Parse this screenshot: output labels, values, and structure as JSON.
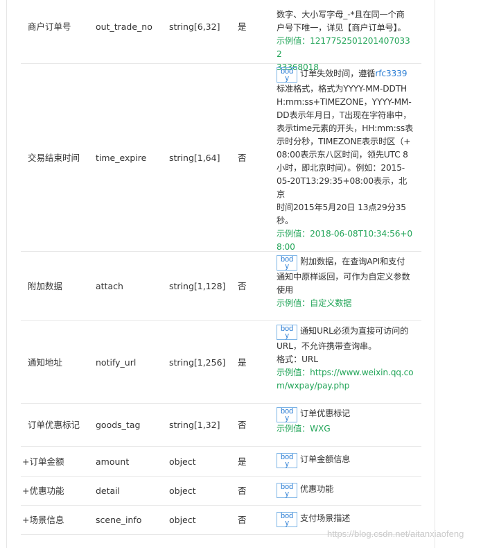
{
  "badge": "body",
  "rows": [
    {
      "name": "商户订单号",
      "field": "out_trade_no",
      "type": "string[6,32]",
      "required": "是",
      "desc_lines": [
        "数字、大小写字母_-*且在同一个商",
        "户号下唯一，详见【商户订单号】。"
      ],
      "example_lines": [
        "示例值：12177525012014070332",
        "33368018"
      ]
    },
    {
      "name": "交易结束时间",
      "field": "time_expire",
      "type": "string[1,64]",
      "required": "否",
      "desc_first": "订单失效时间，遵循",
      "desc_link": "rfc3339",
      "desc_lines": [
        "标准格式，格式为YYYY-MM-DDTH",
        "H:mm:ss+TIMEZONE，YYYY-MM-",
        "DD表示年月日，T出现在字符串中，",
        "表示time元素的开头，HH:mm:ss表",
        "示时分秒，TIMEZONE表示时区（+",
        "08:00表示东八区时间，领先UTC 8",
        "小时，即北京时间）。例如：2015-",
        "05-20T13:29:35+08:00表示，北京",
        "时间2015年5月20日 13点29分35",
        "秒。"
      ],
      "example_lines": [
        "示例值：2018-06-08T10:34:56+0",
        "8:00"
      ]
    },
    {
      "name": "附加数据",
      "field": "attach",
      "type": "string[1,128]",
      "required": "否",
      "desc_first": "附加数据，在查询API和支付",
      "desc_lines": [
        "通知中原样返回，可作为自定义参数",
        "使用"
      ],
      "example_lines": [
        "示例值：自定义数据"
      ]
    },
    {
      "name": "通知地址",
      "field": "notify_url",
      "type": "string[1,256]",
      "required": "是",
      "desc_first": "通知URL必须为直接可访问的",
      "desc_lines": [
        "URL，不允许携带查询串。",
        "格式：URL"
      ],
      "example_lines": [
        "示例值：https://www.weixin.qq.co",
        "m/wxpay/pay.php"
      ]
    },
    {
      "name": "订单优惠标记",
      "field": "goods_tag",
      "type": "string[1,32]",
      "required": "否",
      "desc_first": "订单优惠标记",
      "example_lines": [
        "示例值：WXG"
      ]
    },
    {
      "name": "+订单金额",
      "field": "amount",
      "type": "object",
      "required": "是",
      "desc_first": "订单金额信息"
    },
    {
      "name": "+优惠功能",
      "field": "detail",
      "type": "object",
      "required": "否",
      "desc_first": "优惠功能"
    },
    {
      "name": "+场景信息",
      "field": "scene_info",
      "type": "object",
      "required": "否",
      "desc_first": "支付场景描述"
    }
  ],
  "watermark": "https://blog.csdn.net/aitanxiaofeng"
}
